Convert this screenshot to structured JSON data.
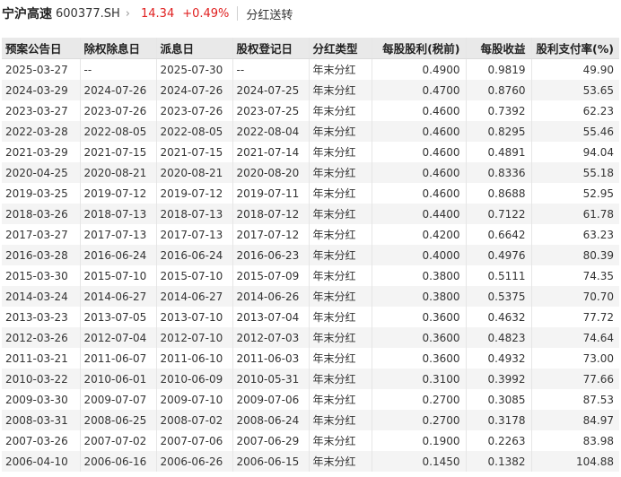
{
  "header": {
    "stock_name": "宁沪高速",
    "stock_code": "600377.SH",
    "price": "14.34",
    "change": "+0.49%",
    "section": "分红送转",
    "accent_color": "#e02020"
  },
  "table": {
    "columns": [
      "预案公告日",
      "除权除息日",
      "派息日",
      "股权登记日",
      "分红类型",
      "每股股利(税前)",
      "每股收益",
      "股利支付率(%)"
    ],
    "rows": [
      [
        "2025-03-27",
        "--",
        "2025-07-30",
        "--",
        "年末分红",
        "0.4900",
        "0.9819",
        "49.90"
      ],
      [
        "2024-03-29",
        "2024-07-26",
        "2024-07-26",
        "2024-07-25",
        "年末分红",
        "0.4700",
        "0.8760",
        "53.65"
      ],
      [
        "2023-03-27",
        "2023-07-26",
        "2023-07-26",
        "2023-07-25",
        "年末分红",
        "0.4600",
        "0.7392",
        "62.23"
      ],
      [
        "2022-03-28",
        "2022-08-05",
        "2022-08-05",
        "2022-08-04",
        "年末分红",
        "0.4600",
        "0.8295",
        "55.46"
      ],
      [
        "2021-03-29",
        "2021-07-15",
        "2021-07-15",
        "2021-07-14",
        "年末分红",
        "0.4600",
        "0.4891",
        "94.04"
      ],
      [
        "2020-04-25",
        "2020-08-21",
        "2020-08-21",
        "2020-08-20",
        "年末分红",
        "0.4600",
        "0.8336",
        "55.18"
      ],
      [
        "2019-03-25",
        "2019-07-12",
        "2019-07-12",
        "2019-07-11",
        "年末分红",
        "0.4600",
        "0.8688",
        "52.95"
      ],
      [
        "2018-03-26",
        "2018-07-13",
        "2018-07-13",
        "2018-07-12",
        "年末分红",
        "0.4400",
        "0.7122",
        "61.78"
      ],
      [
        "2017-03-27",
        "2017-07-13",
        "2017-07-13",
        "2017-07-12",
        "年末分红",
        "0.4200",
        "0.6642",
        "63.23"
      ],
      [
        "2016-03-28",
        "2016-06-24",
        "2016-06-24",
        "2016-06-23",
        "年末分红",
        "0.4000",
        "0.4976",
        "80.39"
      ],
      [
        "2015-03-30",
        "2015-07-10",
        "2015-07-10",
        "2015-07-09",
        "年末分红",
        "0.3800",
        "0.5111",
        "74.35"
      ],
      [
        "2014-03-24",
        "2014-06-27",
        "2014-06-27",
        "2014-06-26",
        "年末分红",
        "0.3800",
        "0.5375",
        "70.70"
      ],
      [
        "2013-03-23",
        "2013-07-05",
        "2013-07-10",
        "2013-07-04",
        "年末分红",
        "0.3600",
        "0.4632",
        "77.72"
      ],
      [
        "2012-03-26",
        "2012-07-04",
        "2012-07-10",
        "2012-07-03",
        "年末分红",
        "0.3600",
        "0.4823",
        "74.64"
      ],
      [
        "2011-03-21",
        "2011-06-07",
        "2011-06-10",
        "2011-06-03",
        "年末分红",
        "0.3600",
        "0.4932",
        "73.00"
      ],
      [
        "2010-03-22",
        "2010-06-01",
        "2010-06-09",
        "2010-05-31",
        "年末分红",
        "0.3100",
        "0.3992",
        "77.66"
      ],
      [
        "2009-03-30",
        "2009-07-07",
        "2009-07-10",
        "2009-07-06",
        "年末分红",
        "0.2700",
        "0.3085",
        "87.53"
      ],
      [
        "2008-03-31",
        "2008-06-25",
        "2008-07-02",
        "2008-06-24",
        "年末分红",
        "0.2700",
        "0.3178",
        "84.97"
      ],
      [
        "2007-03-26",
        "2007-07-02",
        "2007-07-06",
        "2007-06-29",
        "年末分红",
        "0.1900",
        "0.2263",
        "83.98"
      ],
      [
        "2006-04-10",
        "2006-06-16",
        "2006-06-26",
        "2006-06-15",
        "年末分红",
        "0.1450",
        "0.1382",
        "104.88"
      ]
    ]
  }
}
